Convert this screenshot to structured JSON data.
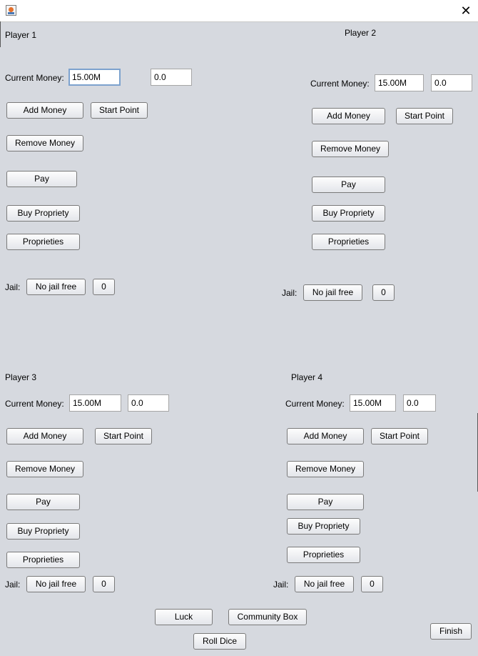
{
  "window": {
    "close_glyph": "✕"
  },
  "labels": {
    "current_money": "Current Money:",
    "jail": "Jail:"
  },
  "buttons": {
    "add_money": "Add Money",
    "start_point": "Start Point",
    "remove_money": "Remove Money",
    "pay": "Pay",
    "buy_propriety": "Buy Propriety",
    "proprieties": "Proprieties",
    "no_jail_free": "No jail free"
  },
  "players": [
    {
      "name": "Player 1",
      "money": "15.00M",
      "amount": "0.0",
      "jail_count": "0"
    },
    {
      "name": "Player 2",
      "money": "15.00M",
      "amount": "0.0",
      "jail_count": "0"
    },
    {
      "name": "Player 3",
      "money": "15.00M",
      "amount": "0.0",
      "jail_count": "0"
    },
    {
      "name": "Player 4",
      "money": "15.00M",
      "amount": "0.0",
      "jail_count": "0"
    }
  ],
  "bottom": {
    "luck": "Luck",
    "community_box": "Community Box",
    "roll_dice": "Roll Dice",
    "finish": "Finish"
  }
}
